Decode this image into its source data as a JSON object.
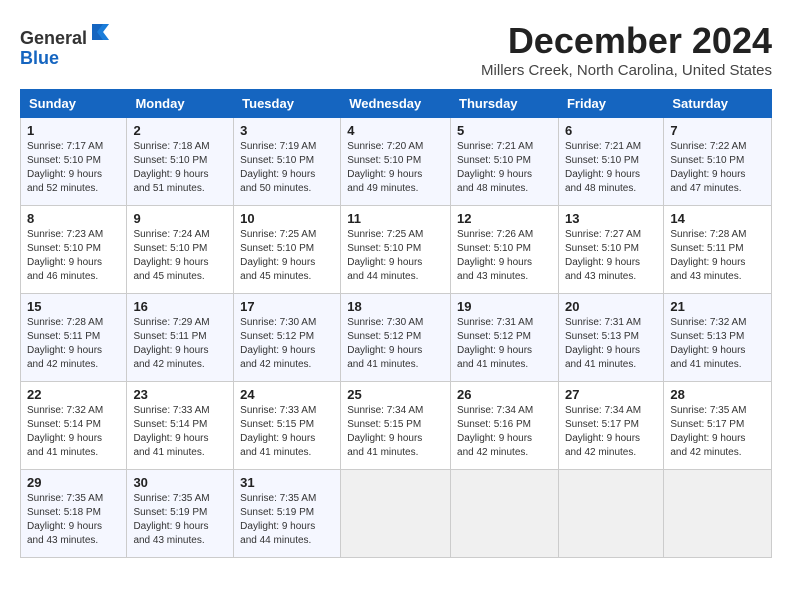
{
  "logo": {
    "general": "General",
    "blue": "Blue"
  },
  "title": "December 2024",
  "subtitle": "Millers Creek, North Carolina, United States",
  "days_of_week": [
    "Sunday",
    "Monday",
    "Tuesday",
    "Wednesday",
    "Thursday",
    "Friday",
    "Saturday"
  ],
  "weeks": [
    [
      {
        "day": 1,
        "info": "Sunrise: 7:17 AM\nSunset: 5:10 PM\nDaylight: 9 hours\nand 52 minutes."
      },
      {
        "day": 2,
        "info": "Sunrise: 7:18 AM\nSunset: 5:10 PM\nDaylight: 9 hours\nand 51 minutes."
      },
      {
        "day": 3,
        "info": "Sunrise: 7:19 AM\nSunset: 5:10 PM\nDaylight: 9 hours\nand 50 minutes."
      },
      {
        "day": 4,
        "info": "Sunrise: 7:20 AM\nSunset: 5:10 PM\nDaylight: 9 hours\nand 49 minutes."
      },
      {
        "day": 5,
        "info": "Sunrise: 7:21 AM\nSunset: 5:10 PM\nDaylight: 9 hours\nand 48 minutes."
      },
      {
        "day": 6,
        "info": "Sunrise: 7:21 AM\nSunset: 5:10 PM\nDaylight: 9 hours\nand 48 minutes."
      },
      {
        "day": 7,
        "info": "Sunrise: 7:22 AM\nSunset: 5:10 PM\nDaylight: 9 hours\nand 47 minutes."
      }
    ],
    [
      {
        "day": 8,
        "info": "Sunrise: 7:23 AM\nSunset: 5:10 PM\nDaylight: 9 hours\nand 46 minutes."
      },
      {
        "day": 9,
        "info": "Sunrise: 7:24 AM\nSunset: 5:10 PM\nDaylight: 9 hours\nand 45 minutes."
      },
      {
        "day": 10,
        "info": "Sunrise: 7:25 AM\nSunset: 5:10 PM\nDaylight: 9 hours\nand 45 minutes."
      },
      {
        "day": 11,
        "info": "Sunrise: 7:25 AM\nSunset: 5:10 PM\nDaylight: 9 hours\nand 44 minutes."
      },
      {
        "day": 12,
        "info": "Sunrise: 7:26 AM\nSunset: 5:10 PM\nDaylight: 9 hours\nand 43 minutes."
      },
      {
        "day": 13,
        "info": "Sunrise: 7:27 AM\nSunset: 5:10 PM\nDaylight: 9 hours\nand 43 minutes."
      },
      {
        "day": 14,
        "info": "Sunrise: 7:28 AM\nSunset: 5:11 PM\nDaylight: 9 hours\nand 43 minutes."
      }
    ],
    [
      {
        "day": 15,
        "info": "Sunrise: 7:28 AM\nSunset: 5:11 PM\nDaylight: 9 hours\nand 42 minutes."
      },
      {
        "day": 16,
        "info": "Sunrise: 7:29 AM\nSunset: 5:11 PM\nDaylight: 9 hours\nand 42 minutes."
      },
      {
        "day": 17,
        "info": "Sunrise: 7:30 AM\nSunset: 5:12 PM\nDaylight: 9 hours\nand 42 minutes."
      },
      {
        "day": 18,
        "info": "Sunrise: 7:30 AM\nSunset: 5:12 PM\nDaylight: 9 hours\nand 41 minutes."
      },
      {
        "day": 19,
        "info": "Sunrise: 7:31 AM\nSunset: 5:12 PM\nDaylight: 9 hours\nand 41 minutes."
      },
      {
        "day": 20,
        "info": "Sunrise: 7:31 AM\nSunset: 5:13 PM\nDaylight: 9 hours\nand 41 minutes."
      },
      {
        "day": 21,
        "info": "Sunrise: 7:32 AM\nSunset: 5:13 PM\nDaylight: 9 hours\nand 41 minutes."
      }
    ],
    [
      {
        "day": 22,
        "info": "Sunrise: 7:32 AM\nSunset: 5:14 PM\nDaylight: 9 hours\nand 41 minutes."
      },
      {
        "day": 23,
        "info": "Sunrise: 7:33 AM\nSunset: 5:14 PM\nDaylight: 9 hours\nand 41 minutes."
      },
      {
        "day": 24,
        "info": "Sunrise: 7:33 AM\nSunset: 5:15 PM\nDaylight: 9 hours\nand 41 minutes."
      },
      {
        "day": 25,
        "info": "Sunrise: 7:34 AM\nSunset: 5:15 PM\nDaylight: 9 hours\nand 41 minutes."
      },
      {
        "day": 26,
        "info": "Sunrise: 7:34 AM\nSunset: 5:16 PM\nDaylight: 9 hours\nand 42 minutes."
      },
      {
        "day": 27,
        "info": "Sunrise: 7:34 AM\nSunset: 5:17 PM\nDaylight: 9 hours\nand 42 minutes."
      },
      {
        "day": 28,
        "info": "Sunrise: 7:35 AM\nSunset: 5:17 PM\nDaylight: 9 hours\nand 42 minutes."
      }
    ],
    [
      {
        "day": 29,
        "info": "Sunrise: 7:35 AM\nSunset: 5:18 PM\nDaylight: 9 hours\nand 43 minutes."
      },
      {
        "day": 30,
        "info": "Sunrise: 7:35 AM\nSunset: 5:19 PM\nDaylight: 9 hours\nand 43 minutes."
      },
      {
        "day": 31,
        "info": "Sunrise: 7:35 AM\nSunset: 5:19 PM\nDaylight: 9 hours\nand 44 minutes."
      },
      null,
      null,
      null,
      null
    ]
  ]
}
